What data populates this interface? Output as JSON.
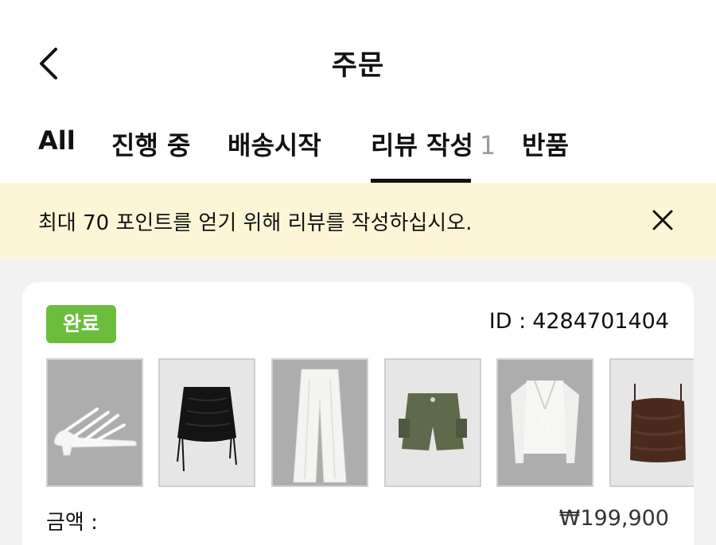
{
  "header": {
    "title": "주문",
    "back_icon": "chevron-left-icon"
  },
  "tabs": [
    {
      "label": "All",
      "count": ""
    },
    {
      "label": "진행 중",
      "count": ""
    },
    {
      "label": "배송시작",
      "count": ""
    },
    {
      "label": "리뷰 작성",
      "count": "1",
      "active": true
    },
    {
      "label": "반품",
      "count": ""
    }
  ],
  "banner": {
    "text": "최대 70 포인트를 얻기 위해 리뷰를 작성하십시오.",
    "close_icon": "close-icon"
  },
  "order": {
    "status": "완료",
    "status_color": "#6cbd3c",
    "id_label": "ID :",
    "id_value": "4284701404",
    "amount_label": "금액 :",
    "amount_value": "₩199,900",
    "products": [
      {
        "name": "white strappy sandals",
        "icon": "sandal-icon"
      },
      {
        "name": "black ruched mini skirt",
        "icon": "skirt-icon"
      },
      {
        "name": "white wide leg pants",
        "icon": "pants-icon"
      },
      {
        "name": "olive cargo shorts",
        "icon": "shorts-icon"
      },
      {
        "name": "white tie front cardigan",
        "icon": "cardigan-icon"
      },
      {
        "name": "brown satin cami top",
        "icon": "cami-icon"
      }
    ]
  }
}
